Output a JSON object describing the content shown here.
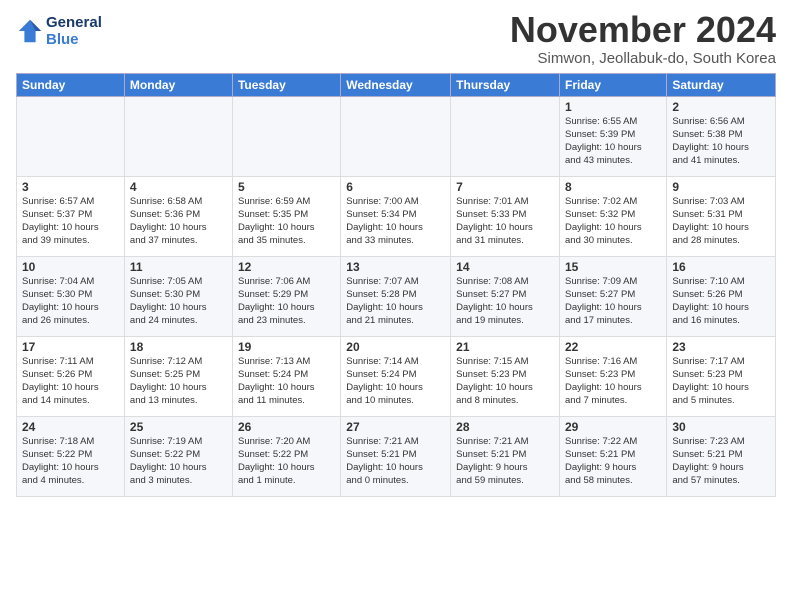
{
  "header": {
    "logo_text_1": "General",
    "logo_text_2": "Blue",
    "month": "November 2024",
    "location": "Simwon, Jeollabuk-do, South Korea"
  },
  "days_of_week": [
    "Sunday",
    "Monday",
    "Tuesday",
    "Wednesday",
    "Thursday",
    "Friday",
    "Saturday"
  ],
  "weeks": [
    {
      "days": [
        {
          "num": "",
          "info": ""
        },
        {
          "num": "",
          "info": ""
        },
        {
          "num": "",
          "info": ""
        },
        {
          "num": "",
          "info": ""
        },
        {
          "num": "",
          "info": ""
        },
        {
          "num": "1",
          "info": "Sunrise: 6:55 AM\nSunset: 5:39 PM\nDaylight: 10 hours\nand 43 minutes."
        },
        {
          "num": "2",
          "info": "Sunrise: 6:56 AM\nSunset: 5:38 PM\nDaylight: 10 hours\nand 41 minutes."
        }
      ]
    },
    {
      "days": [
        {
          "num": "3",
          "info": "Sunrise: 6:57 AM\nSunset: 5:37 PM\nDaylight: 10 hours\nand 39 minutes."
        },
        {
          "num": "4",
          "info": "Sunrise: 6:58 AM\nSunset: 5:36 PM\nDaylight: 10 hours\nand 37 minutes."
        },
        {
          "num": "5",
          "info": "Sunrise: 6:59 AM\nSunset: 5:35 PM\nDaylight: 10 hours\nand 35 minutes."
        },
        {
          "num": "6",
          "info": "Sunrise: 7:00 AM\nSunset: 5:34 PM\nDaylight: 10 hours\nand 33 minutes."
        },
        {
          "num": "7",
          "info": "Sunrise: 7:01 AM\nSunset: 5:33 PM\nDaylight: 10 hours\nand 31 minutes."
        },
        {
          "num": "8",
          "info": "Sunrise: 7:02 AM\nSunset: 5:32 PM\nDaylight: 10 hours\nand 30 minutes."
        },
        {
          "num": "9",
          "info": "Sunrise: 7:03 AM\nSunset: 5:31 PM\nDaylight: 10 hours\nand 28 minutes."
        }
      ]
    },
    {
      "days": [
        {
          "num": "10",
          "info": "Sunrise: 7:04 AM\nSunset: 5:30 PM\nDaylight: 10 hours\nand 26 minutes."
        },
        {
          "num": "11",
          "info": "Sunrise: 7:05 AM\nSunset: 5:30 PM\nDaylight: 10 hours\nand 24 minutes."
        },
        {
          "num": "12",
          "info": "Sunrise: 7:06 AM\nSunset: 5:29 PM\nDaylight: 10 hours\nand 23 minutes."
        },
        {
          "num": "13",
          "info": "Sunrise: 7:07 AM\nSunset: 5:28 PM\nDaylight: 10 hours\nand 21 minutes."
        },
        {
          "num": "14",
          "info": "Sunrise: 7:08 AM\nSunset: 5:27 PM\nDaylight: 10 hours\nand 19 minutes."
        },
        {
          "num": "15",
          "info": "Sunrise: 7:09 AM\nSunset: 5:27 PM\nDaylight: 10 hours\nand 17 minutes."
        },
        {
          "num": "16",
          "info": "Sunrise: 7:10 AM\nSunset: 5:26 PM\nDaylight: 10 hours\nand 16 minutes."
        }
      ]
    },
    {
      "days": [
        {
          "num": "17",
          "info": "Sunrise: 7:11 AM\nSunset: 5:26 PM\nDaylight: 10 hours\nand 14 minutes."
        },
        {
          "num": "18",
          "info": "Sunrise: 7:12 AM\nSunset: 5:25 PM\nDaylight: 10 hours\nand 13 minutes."
        },
        {
          "num": "19",
          "info": "Sunrise: 7:13 AM\nSunset: 5:24 PM\nDaylight: 10 hours\nand 11 minutes."
        },
        {
          "num": "20",
          "info": "Sunrise: 7:14 AM\nSunset: 5:24 PM\nDaylight: 10 hours\nand 10 minutes."
        },
        {
          "num": "21",
          "info": "Sunrise: 7:15 AM\nSunset: 5:23 PM\nDaylight: 10 hours\nand 8 minutes."
        },
        {
          "num": "22",
          "info": "Sunrise: 7:16 AM\nSunset: 5:23 PM\nDaylight: 10 hours\nand 7 minutes."
        },
        {
          "num": "23",
          "info": "Sunrise: 7:17 AM\nSunset: 5:23 PM\nDaylight: 10 hours\nand 5 minutes."
        }
      ]
    },
    {
      "days": [
        {
          "num": "24",
          "info": "Sunrise: 7:18 AM\nSunset: 5:22 PM\nDaylight: 10 hours\nand 4 minutes."
        },
        {
          "num": "25",
          "info": "Sunrise: 7:19 AM\nSunset: 5:22 PM\nDaylight: 10 hours\nand 3 minutes."
        },
        {
          "num": "26",
          "info": "Sunrise: 7:20 AM\nSunset: 5:22 PM\nDaylight: 10 hours\nand 1 minute."
        },
        {
          "num": "27",
          "info": "Sunrise: 7:21 AM\nSunset: 5:21 PM\nDaylight: 10 hours\nand 0 minutes."
        },
        {
          "num": "28",
          "info": "Sunrise: 7:21 AM\nSunset: 5:21 PM\nDaylight: 9 hours\nand 59 minutes."
        },
        {
          "num": "29",
          "info": "Sunrise: 7:22 AM\nSunset: 5:21 PM\nDaylight: 9 hours\nand 58 minutes."
        },
        {
          "num": "30",
          "info": "Sunrise: 7:23 AM\nSunset: 5:21 PM\nDaylight: 9 hours\nand 57 minutes."
        }
      ]
    }
  ]
}
